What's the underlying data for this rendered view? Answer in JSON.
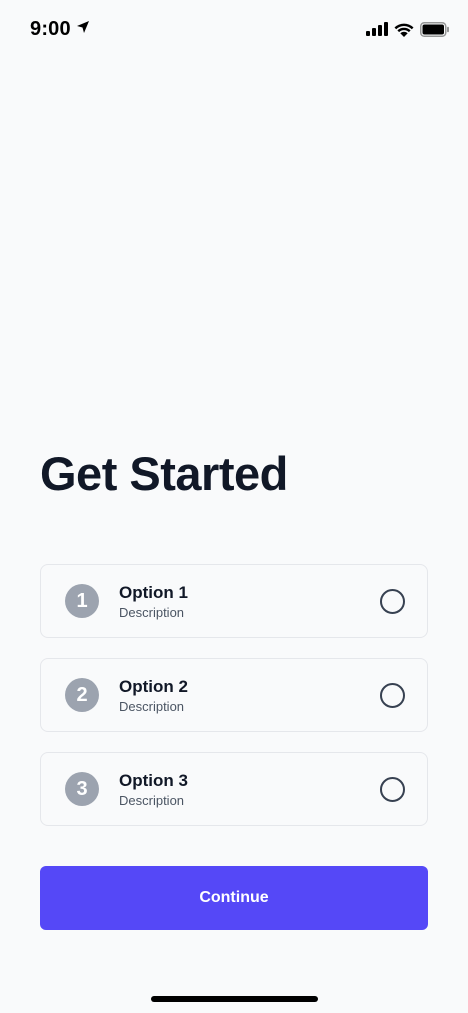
{
  "status_bar": {
    "time": "9:00",
    "icons": [
      "location-arrow-icon",
      "signal-bars-icon",
      "wifi-icon",
      "battery-icon"
    ]
  },
  "main": {
    "title": "Get Started",
    "options": [
      {
        "number": "1",
        "title": "Option 1",
        "description": "Description",
        "selected": false
      },
      {
        "number": "2",
        "title": "Option 2",
        "description": "Description",
        "selected": false
      },
      {
        "number": "3",
        "title": "Option 3",
        "description": "Description",
        "selected": false
      }
    ],
    "continue_label": "Continue"
  },
  "colors": {
    "background": "#f9fafb",
    "primary": "#5548f7",
    "badge": "#9ca3af",
    "text": "#111827"
  }
}
